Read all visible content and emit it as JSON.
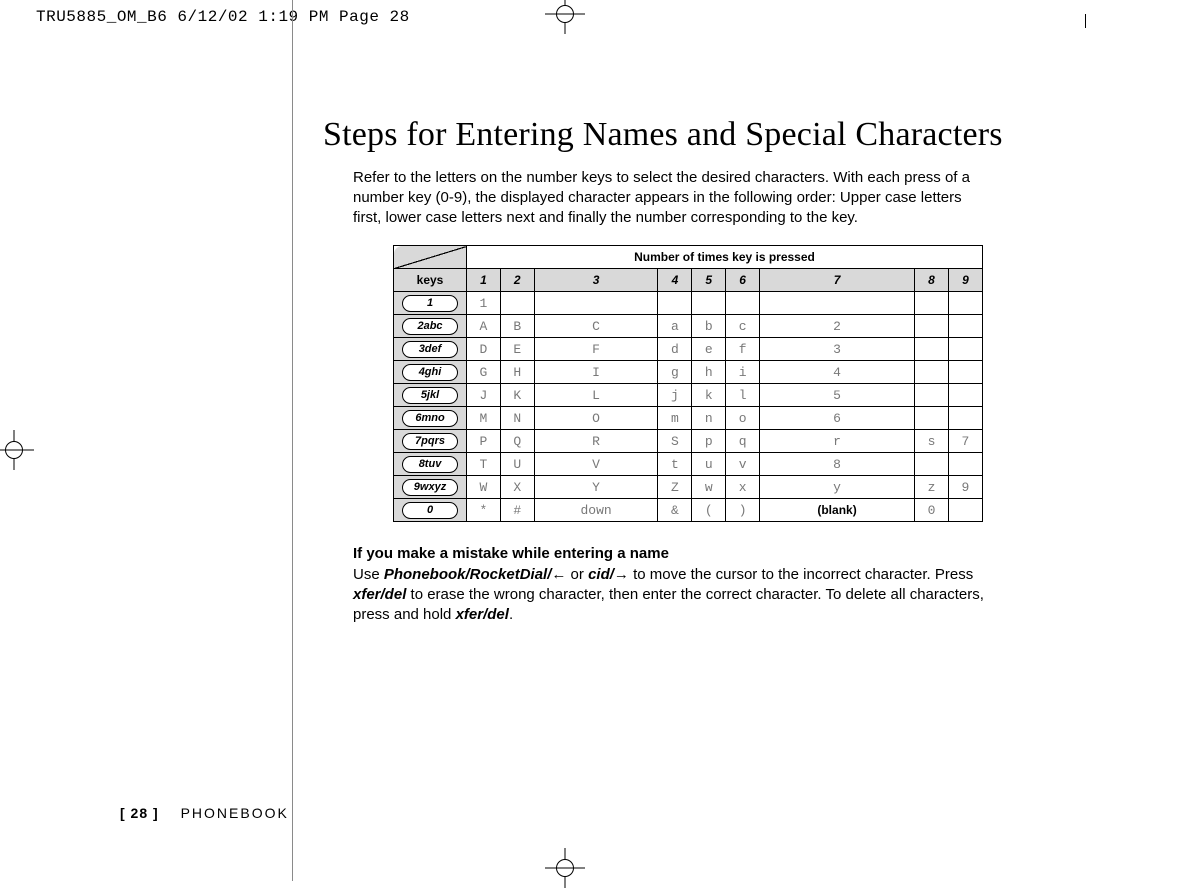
{
  "slug": "TRU5885_OM_B6  6/12/02  1:19 PM  Page 28",
  "title": "Steps for Entering Names and Special Characters",
  "intro": "Refer to the letters on the number keys to select the desired characters. With each press of a number key (0-9), the displayed character appears in the following order: Upper case letters first, lower case letters next and finally the number corresponding to the key.",
  "note_title": "If you make a mistake while entering a name",
  "note_part1": "Use ",
  "note_kbd1": "Phonebook/RocketDial/",
  "note_arrow1": "←",
  "note_or": " or ",
  "note_kbd2": "cid/",
  "note_arrow2": "→",
  "note_part2": " to move the cursor to the incorrect character. Press ",
  "note_kbd3": "xfer/del",
  "note_part3": " to erase the wrong character, then enter the correct character. To delete all characters, press and hold ",
  "note_kbd4": "xfer/del",
  "note_part4": ".",
  "footer_page": "[ 28 ]",
  "footer_section": "PHONEBOOK",
  "table": {
    "top_header": "Number of times key is pressed",
    "keys_label": "keys",
    "columns": [
      "1",
      "2",
      "3",
      "4",
      "5",
      "6",
      "7",
      "8",
      "9"
    ],
    "rows": [
      {
        "key": "1",
        "cells": [
          "1",
          "",
          "",
          "",
          "",
          "",
          "",
          "",
          ""
        ]
      },
      {
        "key": "2abc",
        "cells": [
          "A",
          "B",
          "C",
          "a",
          "b",
          "c",
          "2",
          "",
          ""
        ]
      },
      {
        "key": "3def",
        "cells": [
          "D",
          "E",
          "F",
          "d",
          "e",
          "f",
          "3",
          "",
          ""
        ]
      },
      {
        "key": "4ghi",
        "cells": [
          "G",
          "H",
          "I",
          "g",
          "h",
          "i",
          "4",
          "",
          ""
        ]
      },
      {
        "key": "5jkl",
        "cells": [
          "J",
          "K",
          "L",
          "j",
          "k",
          "l",
          "5",
          "",
          ""
        ]
      },
      {
        "key": "6mno",
        "cells": [
          "M",
          "N",
          "O",
          "m",
          "n",
          "o",
          "6",
          "",
          ""
        ]
      },
      {
        "key": "7pqrs",
        "cells": [
          "P",
          "Q",
          "R",
          "S",
          "p",
          "q",
          "r",
          "s",
          "7"
        ]
      },
      {
        "key": "8tuv",
        "cells": [
          "T",
          "U",
          "V",
          "t",
          "u",
          "v",
          "8",
          "",
          ""
        ]
      },
      {
        "key": "9wxyz",
        "cells": [
          "W",
          "X",
          "Y",
          "Z",
          "w",
          "x",
          "y",
          "z",
          "9"
        ]
      },
      {
        "key": "0",
        "cells": [
          "*",
          "#",
          "down",
          "&",
          "(",
          ")",
          "(blank)",
          "0",
          ""
        ]
      }
    ]
  },
  "chart_data": {
    "type": "table",
    "title": "Number of times key is pressed",
    "row_label": "keys",
    "columns": [
      "1",
      "2",
      "3",
      "4",
      "5",
      "6",
      "7",
      "8",
      "9"
    ],
    "rows": [
      {
        "key": "1",
        "values": [
          "1",
          "",
          "",
          "",
          "",
          "",
          "",
          "",
          ""
        ]
      },
      {
        "key": "2abc",
        "values": [
          "A",
          "B",
          "C",
          "a",
          "b",
          "c",
          "2",
          "",
          ""
        ]
      },
      {
        "key": "3def",
        "values": [
          "D",
          "E",
          "F",
          "d",
          "e",
          "f",
          "3",
          "",
          ""
        ]
      },
      {
        "key": "4ghi",
        "values": [
          "G",
          "H",
          "I",
          "g",
          "h",
          "i",
          "4",
          "",
          ""
        ]
      },
      {
        "key": "5jkl",
        "values": [
          "J",
          "K",
          "L",
          "j",
          "k",
          "l",
          "5",
          "",
          ""
        ]
      },
      {
        "key": "6mno",
        "values": [
          "M",
          "N",
          "O",
          "m",
          "n",
          "o",
          "6",
          "",
          ""
        ]
      },
      {
        "key": "7pqrs",
        "values": [
          "P",
          "Q",
          "R",
          "S",
          "p",
          "q",
          "r",
          "s",
          "7"
        ]
      },
      {
        "key": "8tuv",
        "values": [
          "T",
          "U",
          "V",
          "t",
          "u",
          "v",
          "8",
          "",
          ""
        ]
      },
      {
        "key": "9wxyz",
        "values": [
          "W",
          "X",
          "Y",
          "Z",
          "w",
          "x",
          "y",
          "z",
          "9"
        ]
      },
      {
        "key": "0",
        "values": [
          "*",
          "#",
          "down",
          "&",
          "(",
          ")",
          "(blank)",
          "0",
          ""
        ]
      }
    ]
  }
}
